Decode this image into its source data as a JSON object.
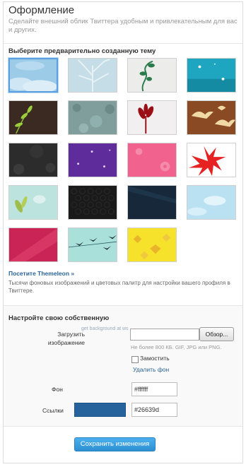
{
  "header": {
    "title": "Оформление",
    "subtitle": "Сделайте внешний облик Твиттера удобным и привлекательным для вас и других."
  },
  "themes": {
    "section_title": "Выберите предварительно созданную тему",
    "selected_index": 0,
    "items": [
      "sky-clouds",
      "frosty-tree",
      "green-vine",
      "blue-sparkles",
      "green-leaves",
      "gray-texture",
      "red-plant",
      "birds-brown",
      "dark-texture",
      "purple-sparkles",
      "pink-flowers",
      "red-leaves",
      "turquoise-leaf",
      "black-hexagon",
      "dark-navy",
      "blue-clouds",
      "pink-stripes",
      "birds-on-wire",
      "yellow-leaves"
    ],
    "themeleon_link": "Посетите Themeleon »",
    "themeleon_desc": "Тысячи фоновых изображений и цветовых палитр для настройки вашего профиля в Твиттере."
  },
  "custom": {
    "section_title": "Настройте свою собственную",
    "upload_label": "Загрузить изображение",
    "hint": "get background at ws",
    "browse_label": "Обзор...",
    "file_note": "Не более 800 КБ. GIF, JPG или PNG.",
    "tile_label": "Замостить",
    "remove_bg": "Удалить фон",
    "bg_label": "Фон",
    "bg_value": "#ffffff",
    "links_label": "Ссылки",
    "links_value": "#26639d",
    "links_color": "#26639d",
    "save_label": "Сохранить изменения"
  }
}
